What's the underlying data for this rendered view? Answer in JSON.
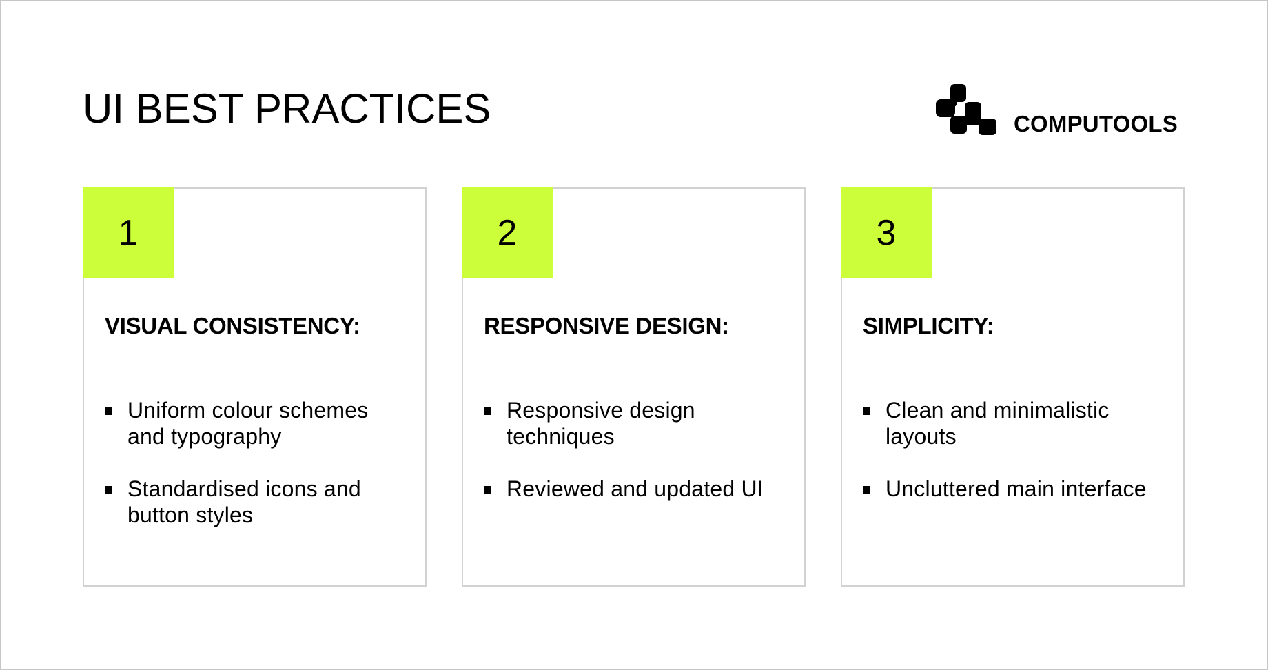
{
  "header": {
    "title": "UI BEST PRACTICES",
    "brand": {
      "name": "COMPUTOOLS",
      "logo_icon": "computools-logo-icon"
    }
  },
  "colors": {
    "accent": "#ccff3a",
    "border": "#d2d2d2",
    "text": "#000000"
  },
  "cards": [
    {
      "number": "1",
      "heading": "VISUAL CONSISTENCY:",
      "bullets": [
        "Uniform colour schemes and typography",
        "Standardised icons and button styles"
      ]
    },
    {
      "number": "2",
      "heading": "RESPONSIVE DESIGN:",
      "bullets": [
        "Responsive design techniques",
        "Reviewed and updated UI"
      ]
    },
    {
      "number": "3",
      "heading": "SIMPLICITY:",
      "bullets": [
        "Clean and minimalistic layouts",
        "Uncluttered main interface"
      ]
    }
  ]
}
